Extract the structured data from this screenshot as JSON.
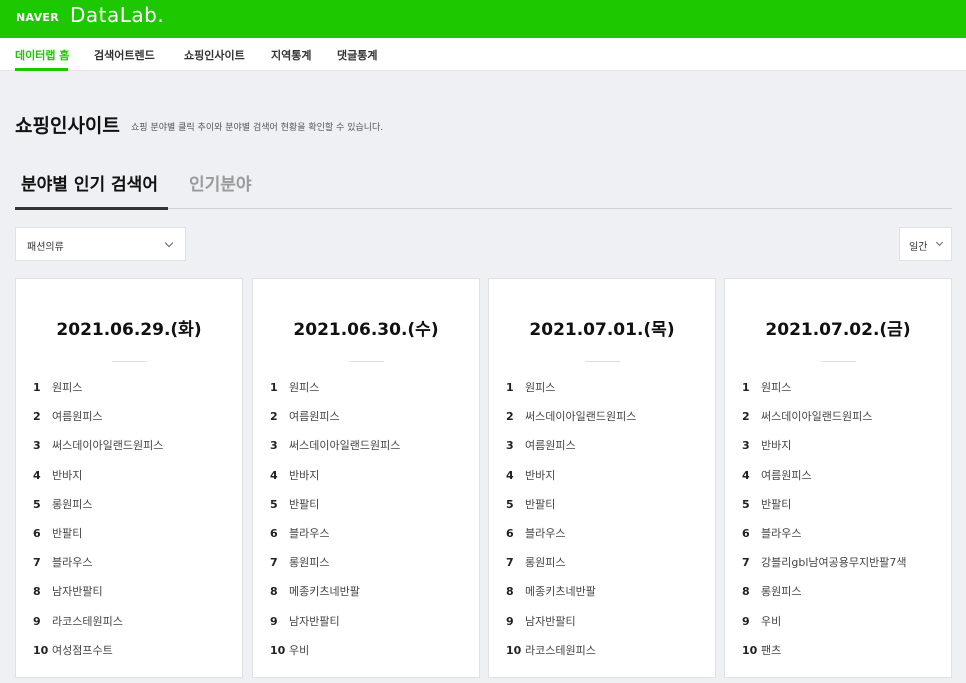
{
  "header": {
    "logo_naver": "NAVER",
    "logo_datalab": "DataLab."
  },
  "nav": [
    {
      "label": "데이터랩 홈",
      "active": true
    },
    {
      "label": "검색어트렌드",
      "active": false
    },
    {
      "label": "쇼핑인사이트",
      "active": false
    },
    {
      "label": "지역통계",
      "active": false
    },
    {
      "label": "댓글통계",
      "active": false
    }
  ],
  "page": {
    "title": "쇼핑인사이트",
    "description": "쇼핑 분야별 클릭 추이와 분야별 검색어 현황을 확인할 수 있습니다."
  },
  "tabs": [
    {
      "label": "분야별 인기 검색어",
      "active": true
    },
    {
      "label": "인기분야",
      "active": false
    }
  ],
  "filters": {
    "category": "패션의류",
    "period": "일간"
  },
  "colors": {
    "brand": "#1ec800",
    "background": "#eef0f4"
  },
  "cards": [
    {
      "date": "2021.06.29.(화)",
      "ranks": [
        {
          "rank": "1",
          "keyword": "원피스"
        },
        {
          "rank": "2",
          "keyword": "여름원피스"
        },
        {
          "rank": "3",
          "keyword": "써스데이아일랜드원피스"
        },
        {
          "rank": "4",
          "keyword": "반바지"
        },
        {
          "rank": "5",
          "keyword": "롱원피스"
        },
        {
          "rank": "6",
          "keyword": "반팔티"
        },
        {
          "rank": "7",
          "keyword": "블라우스"
        },
        {
          "rank": "8",
          "keyword": "남자반팔티"
        },
        {
          "rank": "9",
          "keyword": "라코스테원피스"
        },
        {
          "rank": "10",
          "keyword": "여성점프수트"
        }
      ]
    },
    {
      "date": "2021.06.30.(수)",
      "ranks": [
        {
          "rank": "1",
          "keyword": "원피스"
        },
        {
          "rank": "2",
          "keyword": "여름원피스"
        },
        {
          "rank": "3",
          "keyword": "써스데이아일랜드원피스"
        },
        {
          "rank": "4",
          "keyword": "반바지"
        },
        {
          "rank": "5",
          "keyword": "반팔티"
        },
        {
          "rank": "6",
          "keyword": "블라우스"
        },
        {
          "rank": "7",
          "keyword": "롱원피스"
        },
        {
          "rank": "8",
          "keyword": "메종키츠네반팔"
        },
        {
          "rank": "9",
          "keyword": "남자반팔티"
        },
        {
          "rank": "10",
          "keyword": "우비"
        }
      ]
    },
    {
      "date": "2021.07.01.(목)",
      "ranks": [
        {
          "rank": "1",
          "keyword": "원피스"
        },
        {
          "rank": "2",
          "keyword": "써스데이아일랜드원피스"
        },
        {
          "rank": "3",
          "keyword": "여름원피스"
        },
        {
          "rank": "4",
          "keyword": "반바지"
        },
        {
          "rank": "5",
          "keyword": "반팔티"
        },
        {
          "rank": "6",
          "keyword": "블라우스"
        },
        {
          "rank": "7",
          "keyword": "롱원피스"
        },
        {
          "rank": "8",
          "keyword": "메종키츠네반팔"
        },
        {
          "rank": "9",
          "keyword": "남자반팔티"
        },
        {
          "rank": "10",
          "keyword": "라코스테원피스"
        }
      ]
    },
    {
      "date": "2021.07.02.(금)",
      "ranks": [
        {
          "rank": "1",
          "keyword": "원피스"
        },
        {
          "rank": "2",
          "keyword": "써스데이아일랜드원피스"
        },
        {
          "rank": "3",
          "keyword": "반바지"
        },
        {
          "rank": "4",
          "keyword": "여름원피스"
        },
        {
          "rank": "5",
          "keyword": "반팔티"
        },
        {
          "rank": "6",
          "keyword": "블라우스"
        },
        {
          "rank": "7",
          "keyword": "강블리gbl남여공용무지반팔7색"
        },
        {
          "rank": "8",
          "keyword": "롱원피스"
        },
        {
          "rank": "9",
          "keyword": "우비"
        },
        {
          "rank": "10",
          "keyword": "팬츠"
        }
      ]
    }
  ]
}
